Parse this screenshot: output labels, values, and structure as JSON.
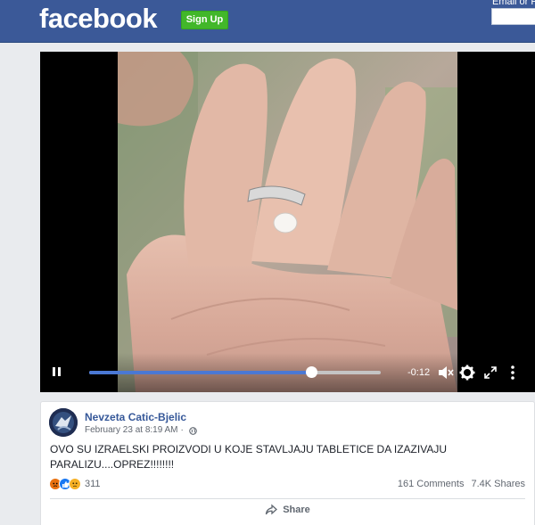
{
  "header": {
    "logo": "facebook",
    "signup_label": "Sign Up",
    "email_label": "Email or Phone"
  },
  "video": {
    "time_remaining": "-0:12",
    "progress_fraction": 0.76,
    "icons": [
      "pause-icon",
      "volume-muted-icon",
      "gear-icon",
      "fullscreen-icon",
      "more-icon"
    ]
  },
  "post": {
    "author": "Nevzeta Catic-Bjelic",
    "date": "February 23 at 8:19 AM",
    "separator": "·",
    "privacy_icon": "globe-icon",
    "text": "OVO SU IZRAELSKI PROIZVODI U KOJE STAVLJAJU TABLETICE DA IZAZIVAJU PARALIZU....OPREZ!!!!!!!!",
    "reactions": [
      "angry",
      "like",
      "sad"
    ],
    "reaction_count": "311",
    "comments": "161 Comments",
    "shares": "7.4K Shares",
    "share_label": "Share"
  },
  "colors": {
    "brand_blue": "#3b5998",
    "signup_green": "#42b72a",
    "link_blue": "#365899",
    "progress_blue": "#4a78d4"
  }
}
